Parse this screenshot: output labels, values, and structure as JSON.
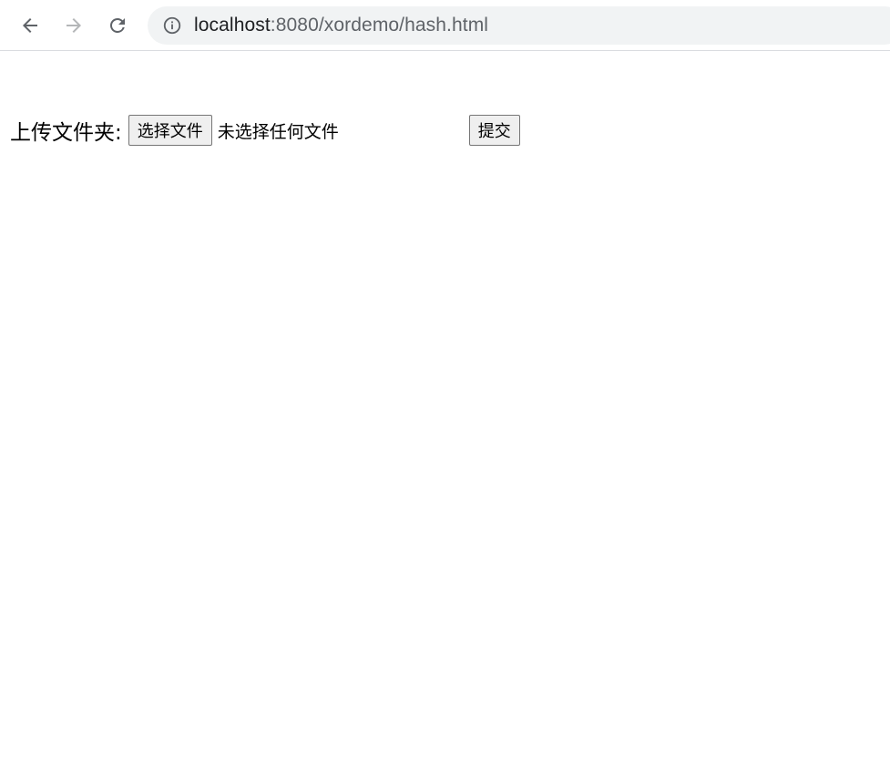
{
  "browser": {
    "url_host": "localhost",
    "url_rest": ":8080/xordemo/hash.html",
    "icons": {
      "back": "arrow-left-icon",
      "forward": "arrow-right-icon",
      "reload": "reload-icon",
      "site_info": "info-icon"
    }
  },
  "form": {
    "label": "上传文件夹:",
    "choose_button": "选择文件",
    "file_status": "未选择任何文件",
    "submit_button": "提交"
  }
}
